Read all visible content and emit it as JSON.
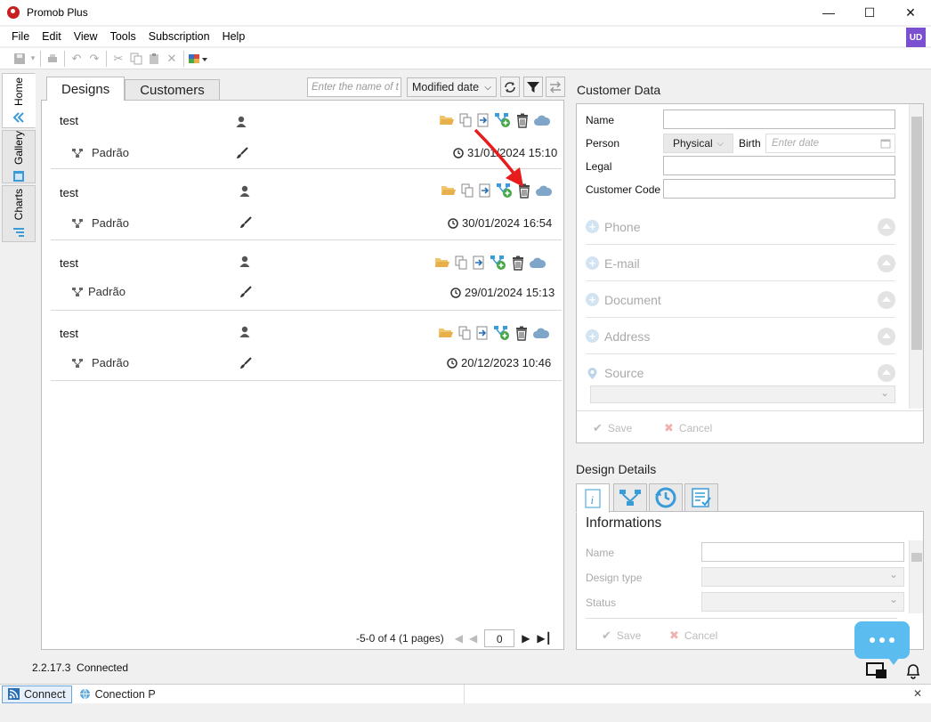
{
  "window": {
    "title": "Promob Plus"
  },
  "menu": [
    "File",
    "Edit",
    "View",
    "Tools",
    "Subscription",
    "Help"
  ],
  "user_initials": "UD",
  "side_tabs": [
    "Home",
    "Gallery",
    "Charts"
  ],
  "designs": {
    "tabs": [
      "Designs",
      "Customers"
    ],
    "search_placeholder": "Enter the name of t",
    "sort_value": "Modified date",
    "items": [
      {
        "name": "test",
        "sub": "Padrão",
        "date": "31/01/2024 15:10"
      },
      {
        "name": "test",
        "sub": "Padrão",
        "date": "30/01/2024 16:54"
      },
      {
        "name": "test",
        "sub": "Padrão",
        "date": "29/01/2024 15:13"
      },
      {
        "name": "test",
        "sub": "Padrão",
        "date": "20/12/2023 10:46"
      }
    ],
    "pagination_text": "-5-0 of 4 (1 pages)",
    "page_value": "0"
  },
  "customer": {
    "title": "Customer Data",
    "labels": {
      "name": "Name",
      "person": "Person",
      "birth": "Birth",
      "legal": "Legal",
      "customer_code": "Customer Code"
    },
    "person_value": "Physical",
    "birth_placeholder": "Enter date",
    "groups": [
      "Phone",
      "E-mail",
      "Document",
      "Address",
      "Source"
    ],
    "save": "Save",
    "cancel": "Cancel"
  },
  "details": {
    "title": "Design Details",
    "section": "Informations",
    "labels": [
      "Name",
      "Design type",
      "Status"
    ],
    "save": "Save",
    "cancel": "Cancel"
  },
  "status": {
    "version": "2.2.17.3",
    "state": "Connected"
  },
  "bottom": {
    "connect": "Connect",
    "connection": "Conection P"
  },
  "colors": {
    "accent": "#3a9bd9",
    "folder": "#e8b04a",
    "brand": "#c8201f",
    "user": "#7a4fd0",
    "arrow": "#e81c1c"
  }
}
